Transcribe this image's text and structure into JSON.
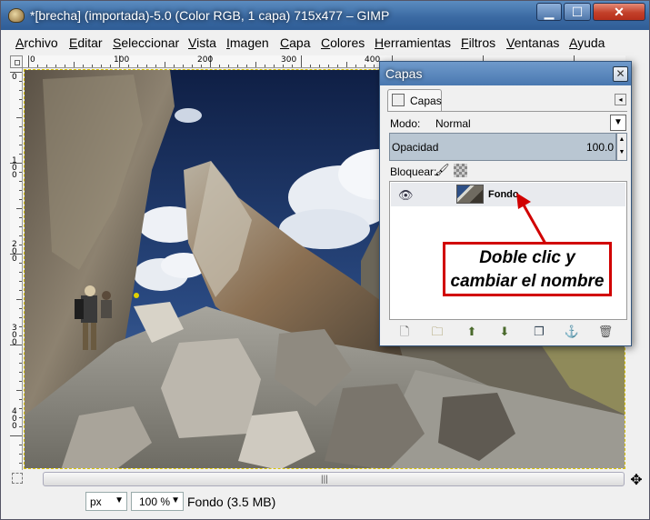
{
  "window": {
    "title": "*[brecha] (importada)-5.0 (Color RGB, 1 capa) 715x477 – GIMP",
    "controls": {
      "minimize": "▁",
      "maximize": "☐",
      "close": "✕"
    }
  },
  "menu": [
    "Archivo",
    "Editar",
    "Seleccionar",
    "Vista",
    "Imagen",
    "Capa",
    "Colores",
    "Herramientas",
    "Filtros",
    "Ventanas",
    "Ayuda"
  ],
  "ruler": {
    "horizontal_labels": [
      "0",
      "100",
      "200",
      "300",
      "400"
    ],
    "vertical_labels": [
      "0",
      "100",
      "200",
      "300",
      "400"
    ]
  },
  "status": {
    "unit": "px",
    "zoom": "100 %",
    "info": "Fondo (3.5 MB)"
  },
  "layers_dialog": {
    "title": "Capas",
    "tab_label": "Capas",
    "mode_label": "Modo:",
    "mode_value": "Normal",
    "opacity_label": "Opacidad",
    "opacity_value": "100.0",
    "lock_label": "Bloquear:",
    "layers": [
      {
        "name": "Fondo",
        "visible": true
      }
    ],
    "bottom_icons": [
      "new-layer-icon",
      "new-group-icon",
      "raise-layer-icon",
      "lower-layer-icon",
      "duplicate-layer-icon",
      "anchor-layer-icon",
      "delete-layer-icon"
    ]
  },
  "annotation": {
    "line1": "Doble clic y",
    "line2": "cambiar el nombre",
    "color": "#d10000"
  }
}
